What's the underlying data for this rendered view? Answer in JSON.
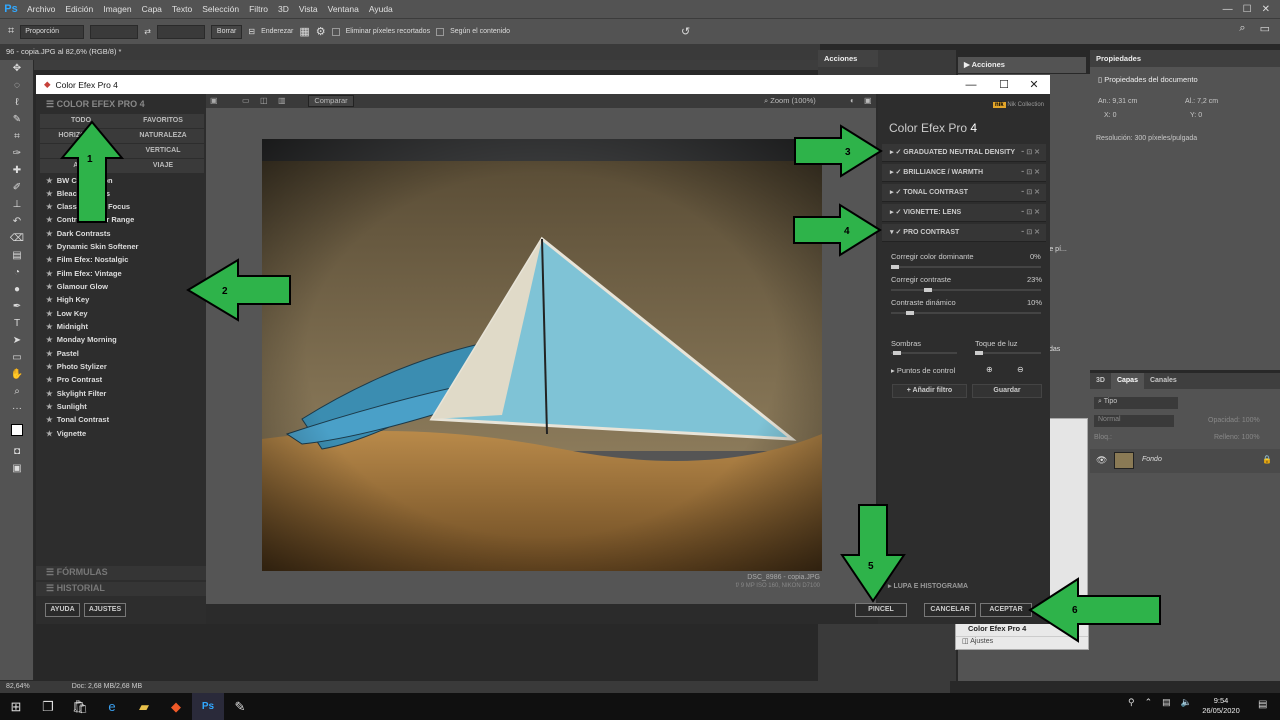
{
  "menubar": {
    "logo": "Ps",
    "items": [
      "Archivo",
      "Edición",
      "Imagen",
      "Capa",
      "Texto",
      "Selección",
      "Filtro",
      "3D",
      "Vista",
      "Ventana",
      "Ayuda"
    ]
  },
  "options": {
    "proportion": "Proporción",
    "clear": "Borrar",
    "straighten": "Enderezar",
    "delete_pixels": "Eliminar píxeles recortados",
    "content_aware": "Según el contenido"
  },
  "document": {
    "tab": "96 - copia.JPG al 82,6% (RGB/8) *"
  },
  "status": {
    "zoom": "82,64%",
    "doc": "Doc: 2,68 MB/2,68 MB"
  },
  "actions_panel": {
    "tab": "Acciones",
    "item": "Acciones"
  },
  "props_panel": {
    "tab": "Propiedades",
    "title": "Propiedades del documento",
    "an_label": "An.:",
    "an_value": "9,31 cm",
    "al_label": "Al.:",
    "al_value": "7,2 cm",
    "x_label": "X:",
    "x_value": "0",
    "y_label": "Y:",
    "y_value": "0",
    "resolution": "Resolución: 300 píxeles/pulgada"
  },
  "layers_panel": {
    "tabs": [
      "3D",
      "Capas",
      "Canales"
    ],
    "kind": "Tipo",
    "blend": "Normal",
    "opacity_label": "Opacidad:",
    "opacity": "100%",
    "lock_label": "Bloq.:",
    "fill_label": "Relleno:",
    "fill": "100%",
    "layer_name": "Fondo"
  },
  "history_panel": {
    "item1": "Color Efex Pro 4",
    "item2": "Ajustes"
  },
  "behind_text": {
    "a": "s de pí...",
    "b": "ecidas"
  },
  "dialog": {
    "title": "Color Efex Pro 4",
    "brand": "COLOR EFEX PRO 4",
    "categories": [
      "TODO",
      "FAVORITOS",
      "HORIZONTAL",
      "NATURALEZA",
      "",
      "VERTICAL",
      "ARQ",
      "VIAJE"
    ],
    "filters": [
      "BW Conversion",
      "Bleach Bypass",
      "Classical Soft Focus",
      "Contrast Color Range",
      "Dark Contrasts",
      "Dynamic Skin Softener",
      "Film Efex: Nostalgic",
      "Film Efex: Vintage",
      "Glamour Glow",
      "High Key",
      "Low Key",
      "Midnight",
      "Monday Morning",
      "Pastel",
      "Photo Stylizer",
      "Pro Contrast",
      "Skylight Filter",
      "Sunlight",
      "Tonal Contrast",
      "Vignette"
    ],
    "formulas": "FÓRMULAS",
    "history": "HISTORIAL",
    "help": "AYUDA",
    "settings": "AJUSTES",
    "compare": "Comparar",
    "zoom": "Zoom (100%)",
    "photo_name": "DSC_8986 - copia.JPG",
    "photo_meta": "f/ 9 MP ISO 160, NIKON D7100",
    "nik": "Nik Collection",
    "panel_title": "Color Efex Pro",
    "panel_version": "4",
    "stack": [
      "GRADUATED NEUTRAL DENSITY",
      "BRILLIANCE / WARMTH",
      "TONAL CONTRAST",
      "VIGNETTE: LENS",
      "PRO CONTRAST"
    ],
    "sliders": [
      {
        "label": "Corregir color dominante",
        "value": "0%"
      },
      {
        "label": "Corregir contraste",
        "value": "23%"
      },
      {
        "label": "Contraste dinámico",
        "value": "10%"
      }
    ],
    "shadows": "Sombras",
    "highlights": "Toque de luz",
    "control_points": "Puntos de control",
    "add_filter": "Añadir filtro",
    "save": "Guardar",
    "loupe": "LUPA E HISTOGRAMA",
    "brush": "PINCEL",
    "cancel": "CANCELAR",
    "accept": "ACEPTAR"
  },
  "annotations": [
    "1",
    "2",
    "3",
    "4",
    "5",
    "6"
  ],
  "taskbar": {
    "time": "9:54",
    "date": "26/05/2020"
  },
  "colors": {
    "arrow": "#2eb34a",
    "ps_panel": "#535353",
    "dialog_bg": "#2b2b2b",
    "accent": "#31a8ff"
  }
}
